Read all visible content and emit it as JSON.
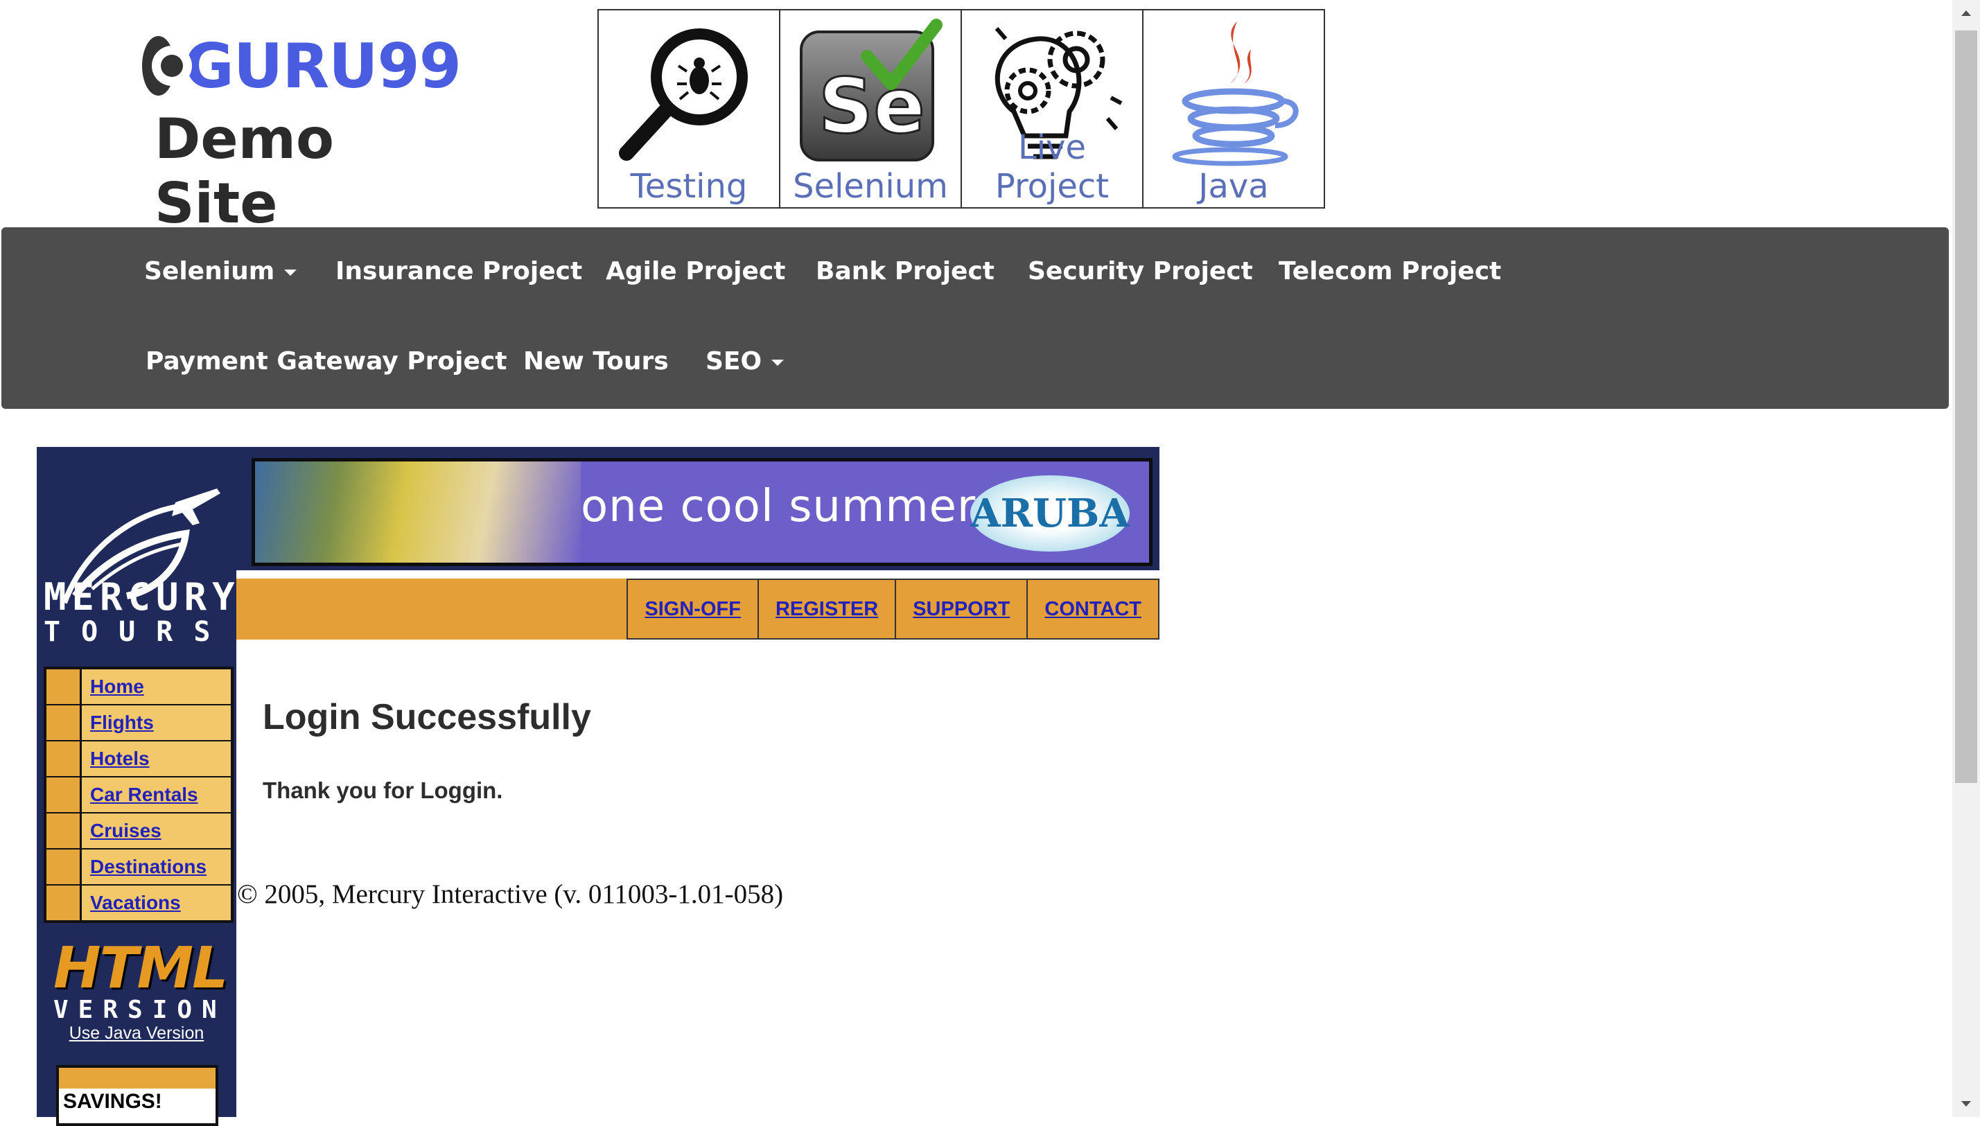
{
  "header": {
    "logo_text": "GURU99",
    "subtitle": "Demo Site",
    "tiles": [
      {
        "label": "Testing",
        "icon": "magnifier-bug-icon"
      },
      {
        "label": "Selenium",
        "icon": "selenium-se-icon"
      },
      {
        "label": "Live Project",
        "icon": "lightbulb-gears-icon"
      },
      {
        "label": "Java",
        "icon": "java-cup-icon"
      }
    ]
  },
  "nav": {
    "row1": [
      "Selenium",
      "Insurance Project",
      "Agile Project",
      "Bank Project",
      "Security Project",
      "Telecom Project"
    ],
    "row2": [
      "Payment Gateway Project",
      "New Tours",
      "SEO"
    ]
  },
  "mercury": {
    "logo_line1": "MERCURY",
    "logo_line2": "TOURS",
    "banner_text": "one cool summer",
    "banner_badge": "ARUBA",
    "top_links": [
      "SIGN-OFF",
      "REGISTER",
      "SUPPORT",
      "CONTACT"
    ],
    "side_menu": [
      "Home",
      "Flights",
      "Hotels",
      "Car Rentals",
      "Cruises",
      "Destinations",
      "Vacations"
    ],
    "html_logo_main": "HTML",
    "html_logo_sub": "VERSION",
    "java_link": "Use Java Version",
    "savings": "SAVINGS!"
  },
  "content": {
    "title": "Login Successfully",
    "message": "Thank you for Loggin.",
    "copyright": "© 2005, Mercury Interactive (v. 011003-1.01-058)"
  },
  "colors": {
    "navbar": "#4d4d4d",
    "mercury_navy": "#1f2a5a",
    "mercury_orange": "#e59f39",
    "link_blue": "#2222bb",
    "guru_blue": "#4a5ce0"
  }
}
